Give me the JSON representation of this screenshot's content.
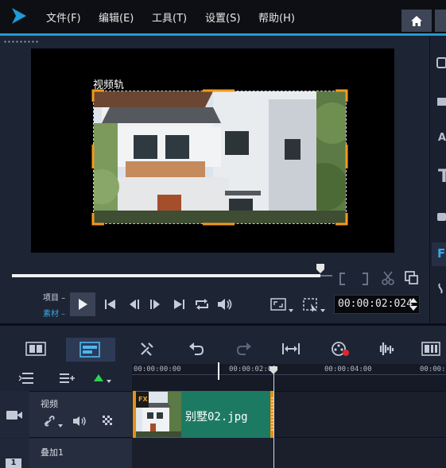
{
  "menu": {
    "file": "文件(F)",
    "edit": "编辑(E)",
    "tools": "工具(T)",
    "settings": "设置(S)",
    "help": "帮助(H)"
  },
  "preview": {
    "track_label": "视频轨",
    "mode_project": "项目",
    "mode_clip": "素材",
    "timecode": "00:00:02:024"
  },
  "right_strip": {
    "letter_a": "A",
    "letter_t": "T",
    "letter_f": "F"
  },
  "timeline": {
    "ruler_ticks": [
      "00:00:00:00",
      "00:00:02:00",
      "00:00:04:00",
      "00:00:0"
    ],
    "tracks": [
      {
        "name": "视频",
        "number": ""
      },
      {
        "name": "叠加1",
        "number": "1"
      }
    ],
    "clip": {
      "name": "别墅02.jpg",
      "fx_badge": "FX"
    }
  },
  "colors": {
    "accent": "#1f9bd8",
    "clip": "#1d7a62",
    "clip_border": "#e3901c",
    "selection_corner": "#f39a1c"
  },
  "icons": {
    "logo": "corel-arrow-logo",
    "home": "home-icon"
  }
}
